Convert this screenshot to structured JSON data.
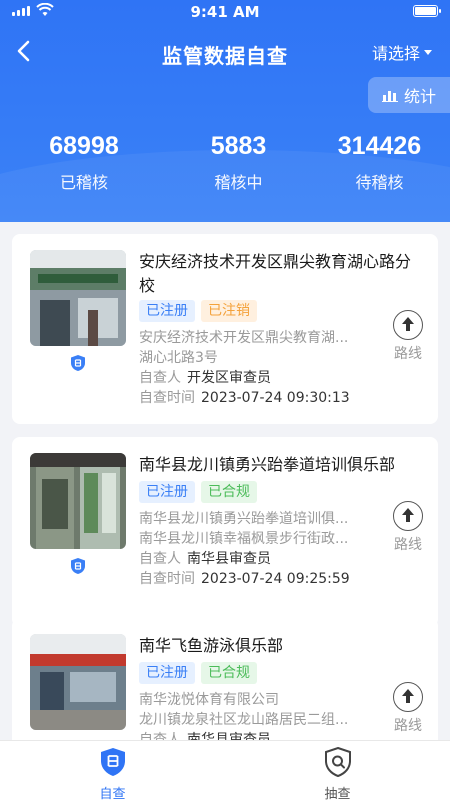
{
  "status_bar": {
    "time": "9:41 AM"
  },
  "nav": {
    "title": "监管数据自查",
    "select_label": "请选择"
  },
  "stat_button": {
    "label": "统计"
  },
  "stats": [
    {
      "value": "68998",
      "label": "已稽核"
    },
    {
      "value": "5883",
      "label": "稽核中"
    },
    {
      "value": "314426",
      "label": "待稽核"
    }
  ],
  "colors": {
    "primary": "#2f74f5",
    "tag_blue": "#3a7ff6",
    "tag_orange": "#f4a23b",
    "tag_green": "#4cbc5a"
  },
  "cards": [
    {
      "name": "安庆经济技术开发区鼎尖教育湖心路分校",
      "tags": [
        "已注册",
        "已注销"
      ],
      "line1": "安庆经济技术开发区鼎尖教育湖...",
      "line2": "湖心北路3号",
      "inspector_label": "自查人",
      "inspector": "开发区审查员",
      "time_label": "自查时间",
      "time": "2023-07-24 09:30:13",
      "route_label": "路线"
    },
    {
      "name": "南华县龙川镇勇兴跆拳道培训俱乐部",
      "tags": [
        "已注册",
        "已合规"
      ],
      "line1": "南华县龙川镇勇兴跆拳道培训俱...",
      "line2": "南华县龙川镇幸福枫景步行街政...",
      "inspector_label": "自查人",
      "inspector": "南华县审查员",
      "time_label": "自查时间",
      "time": "2023-07-24 09:25:59",
      "route_label": "路线"
    },
    {
      "name": "南华飞鱼游泳俱乐部",
      "tags": [
        "已注册",
        "已合规"
      ],
      "line1": "南华泷悦体育有限公司",
      "line2": "龙川镇龙泉社区龙山路居民二组...",
      "inspector_label": "自查人",
      "inspector": "南华县审查员",
      "route_label": "路线"
    }
  ],
  "tabbar": [
    {
      "label": "自查",
      "icon": "shield-self-check-icon"
    },
    {
      "label": "抽查",
      "icon": "shield-spot-check-icon"
    }
  ]
}
